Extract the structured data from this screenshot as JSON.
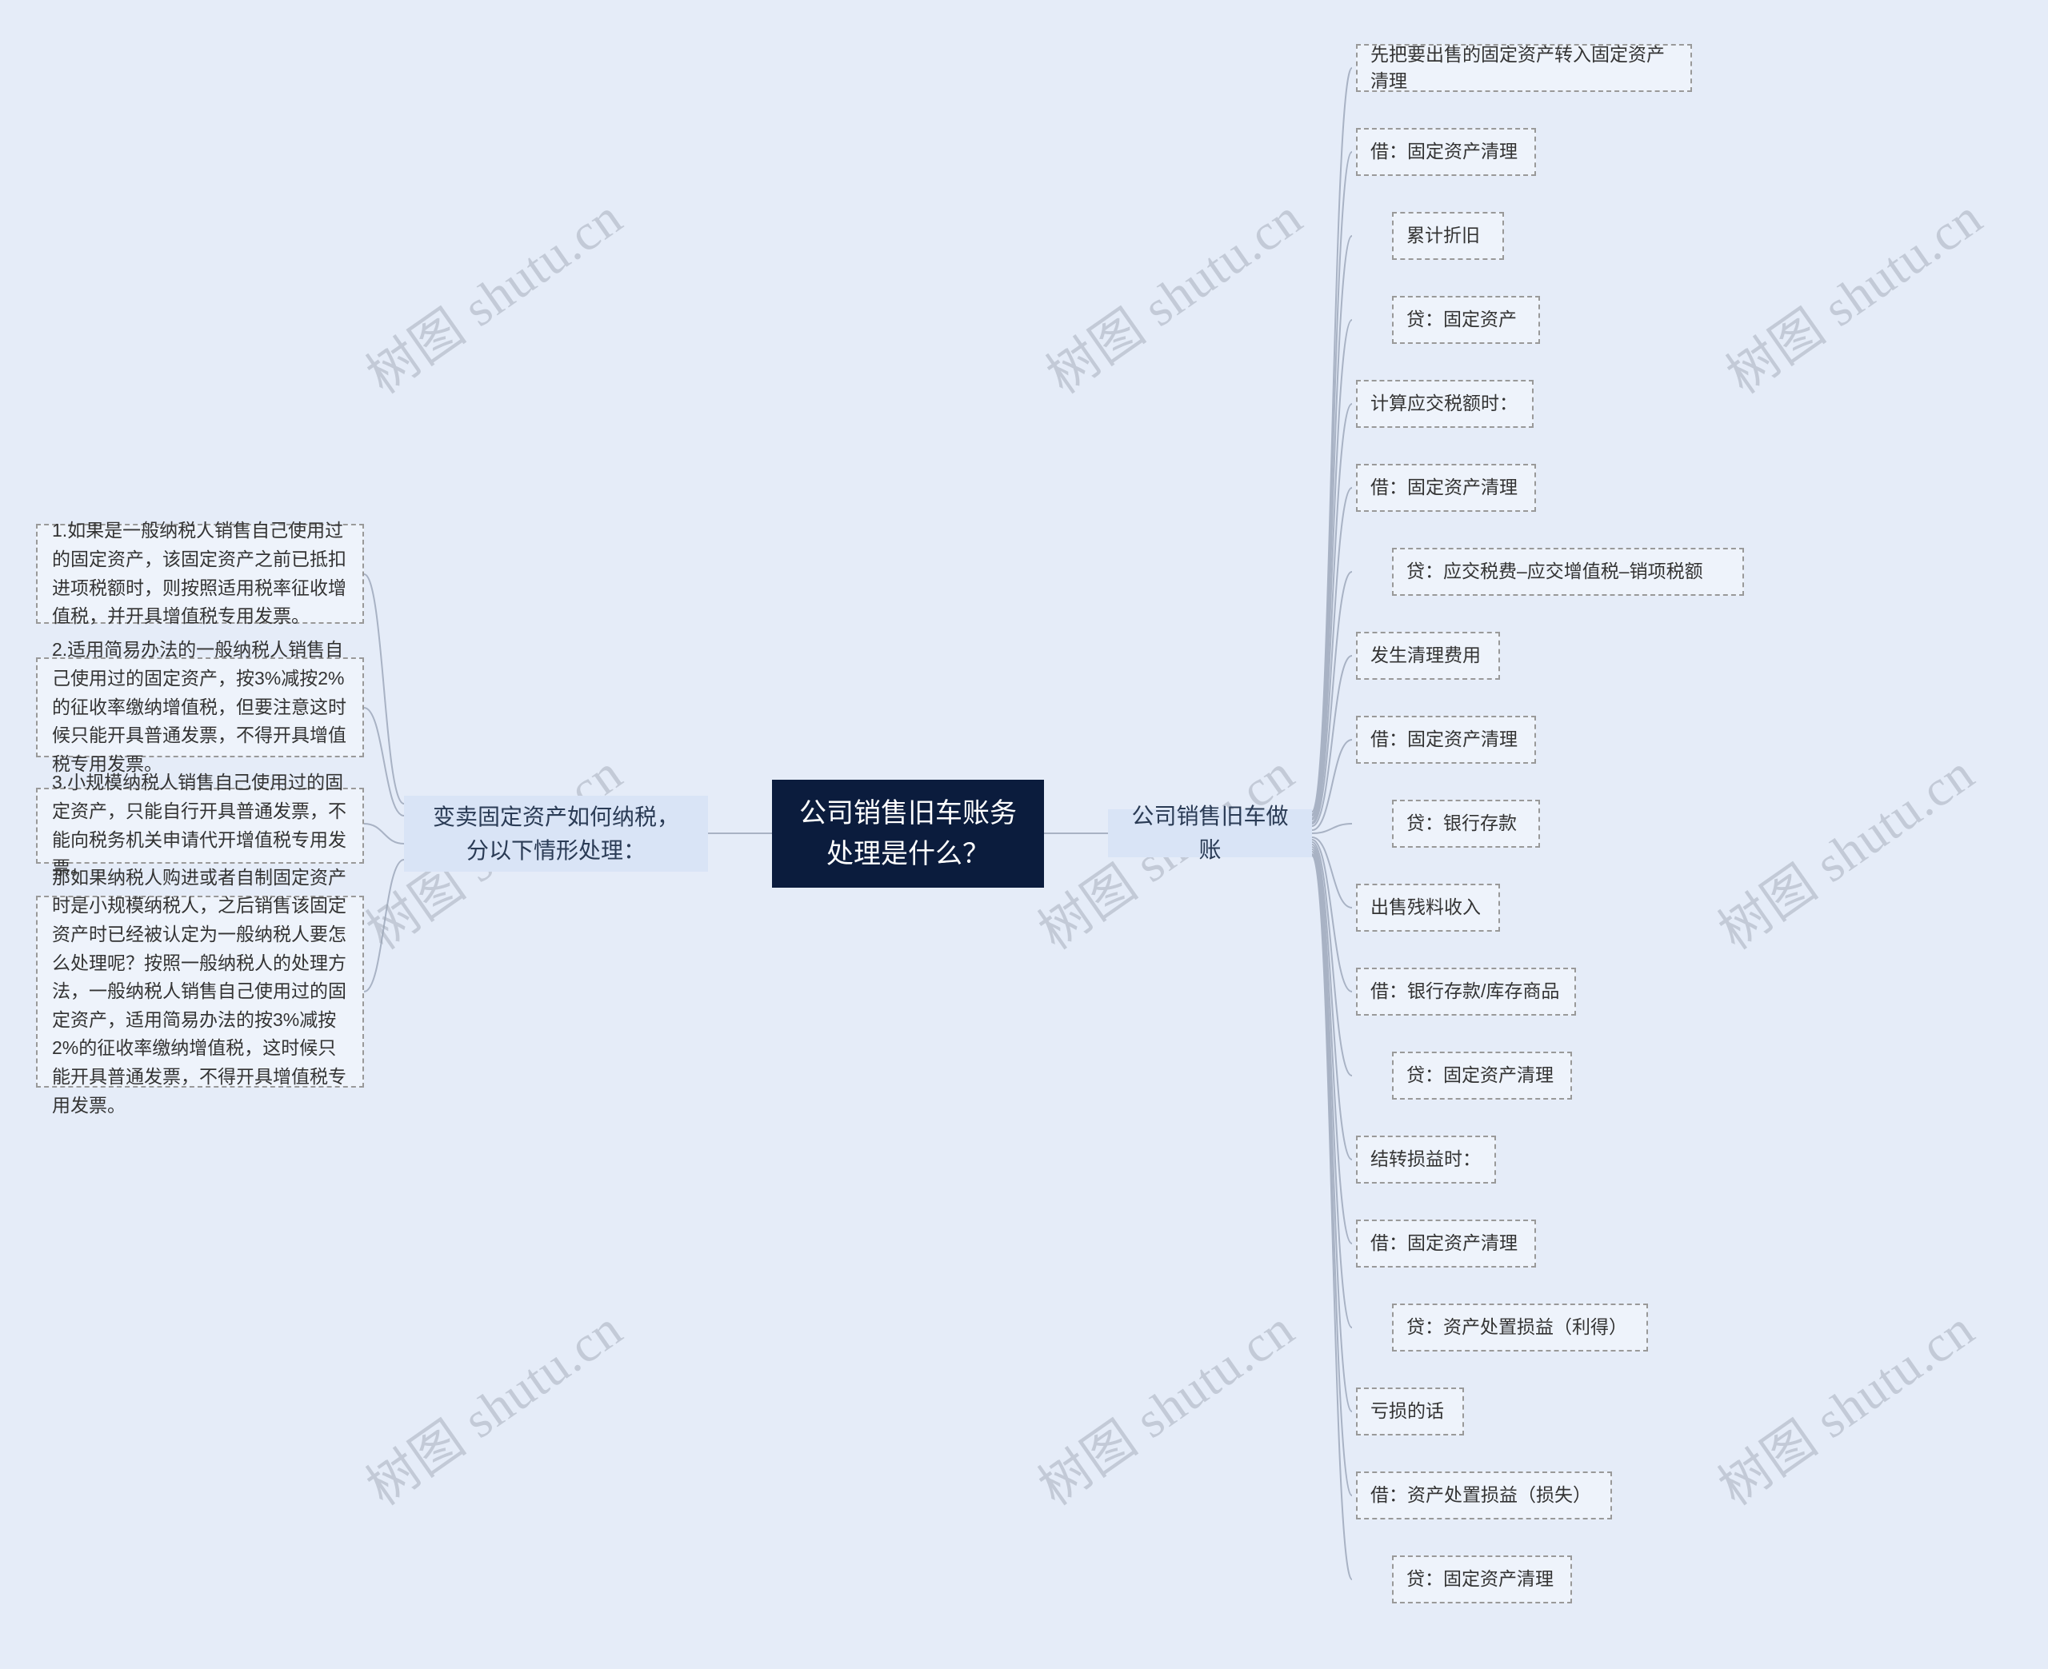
{
  "watermark": "树图 shutu.cn",
  "center": {
    "title": "公司销售旧车账务处理是什么？"
  },
  "left": {
    "branch": "变卖固定资产如何纳税，分以下情形处理：",
    "items": [
      "1.如果是一般纳税人销售自己使用过的固定资产，该固定资产之前已抵扣进项税额时，则按照适用税率征收增值税，并开具增值税专用发票。",
      "2.适用简易办法的一般纳税人销售自己使用过的固定资产，按3%减按2%的征收率缴纳增值税，但要注意这时候只能开具普通发票，不得开具增值税专用发票。",
      "3.小规模纳税人销售自己使用过的固定资产，只能自行开具普通发票，不能向税务机关申请代开增值税专用发票。",
      "那如果纳税人购进或者自制固定资产时是小规模纳税人，之后销售该固定资产时已经被认定为一般纳税人要怎么处理呢？按照一般纳税人的处理方法，一般纳税人销售自己使用过的固定资产，适用简易办法的按3%减按2%的征收率缴纳增值税，这时候只能开具普通发票，不得开具增值税专用发票。"
    ]
  },
  "right": {
    "branch": "公司销售旧车做账",
    "items": [
      "先把要出售的固定资产转入固定资产清理",
      "借：固定资产清理",
      "累计折旧",
      "贷：固定资产",
      "计算应交税额时：",
      "借：固定资产清理",
      "贷：应交税费–应交增值税–销项税额",
      "发生清理费用",
      "借：固定资产清理",
      "贷：银行存款",
      "出售残料收入",
      "借：银行存款/库存商品",
      "贷：固定资产清理",
      "结转损益时：",
      "借：固定资产清理",
      "贷：资产处置损益（利得）",
      "亏损的话",
      "借：资产处置损益（损失）",
      "贷：固定资产清理"
    ]
  }
}
